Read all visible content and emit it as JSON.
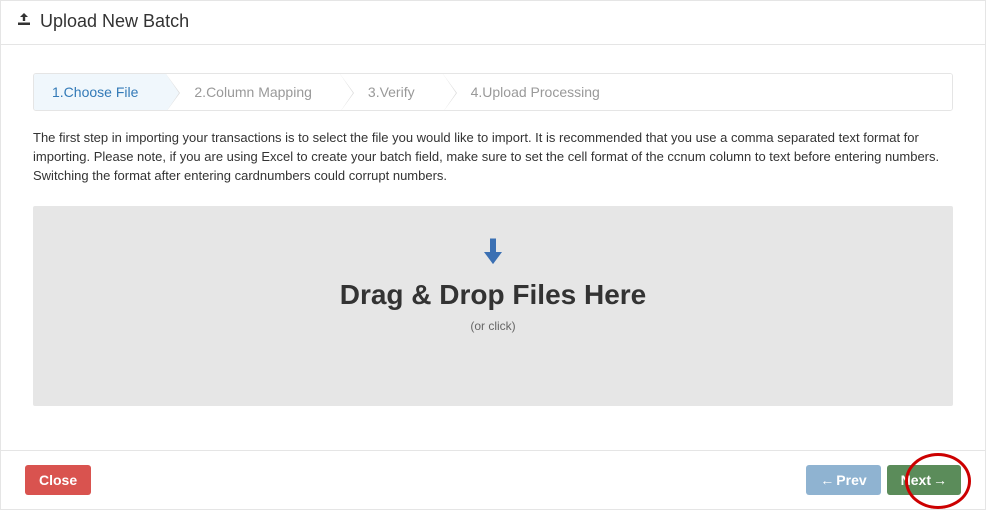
{
  "header": {
    "title": "Upload New Batch"
  },
  "steps": [
    {
      "label": "1.Choose File",
      "active": true
    },
    {
      "label": "2.Column Mapping",
      "active": false
    },
    {
      "label": "3.Verify",
      "active": false
    },
    {
      "label": "4.Upload Processing",
      "active": false
    }
  ],
  "intro_text": "The first step in importing your transactions is to select the file you would like to import. It is recommended that you use a comma separated text format for importing. Please note, if you are using Excel to create your batch field, make sure to set the cell format of the ccnum column to text before entering numbers. Switching the format after entering cardnumbers could corrupt numbers.",
  "dropzone": {
    "title": "Drag & Drop Files Here",
    "subtitle": "(or click)"
  },
  "footer": {
    "close_label": "Close",
    "prev_label": "Prev",
    "next_label": "Next"
  },
  "colors": {
    "accent_link": "#337ab7",
    "danger": "#d9534f",
    "success": "#5b8c5a",
    "muted_button": "#8fb3d1",
    "highlight_ring": "#cc0000"
  }
}
